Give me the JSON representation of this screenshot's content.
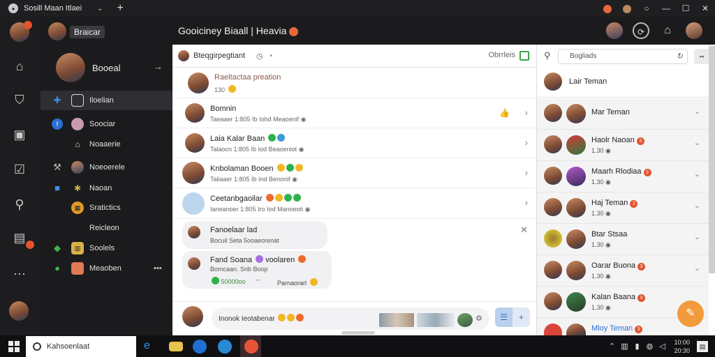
{
  "window": {
    "title": "Sosill Maan Itlaei",
    "controls": [
      "—",
      "☐",
      "✕"
    ]
  },
  "rail": {
    "items": [
      "home-icon",
      "shield-icon",
      "store-icon",
      "checklist-icon",
      "connect-icon",
      "document-icon",
      "more-icon"
    ]
  },
  "sidebar": {
    "header_label": "Braicar",
    "profile_name": "Booeal",
    "items": [
      {
        "label": "Iloelian",
        "lead": "puzzle-icon"
      },
      {
        "label": "Soociar",
        "lead": "circle-icon"
      },
      {
        "label": "Noaaerie",
        "lead": ""
      },
      {
        "label": "Noeoerele",
        "lead": "wrench-icon"
      },
      {
        "label": "Naoan",
        "lead": "folder-icon"
      },
      {
        "label": "Sratictics",
        "lead": ""
      },
      {
        "label": "Reicleon",
        "lead": ""
      },
      {
        "label": "Soolels",
        "lead": "leaf-icon"
      },
      {
        "label": "Meaoben",
        "lead": "status-icon",
        "trailing": "•••"
      }
    ]
  },
  "header": {
    "title": "Gooiciney Biaall | Heavia"
  },
  "chat": {
    "title": "Bteqgirpegtiant",
    "clock": "◷",
    "right_label": "Obrrleis",
    "messages": [
      {
        "name": "Raeltactaa preation",
        "sub": "130"
      },
      {
        "name": "Bomnin",
        "sub": "Taeaaer 1:805 Ib Iohd Meaoenif"
      },
      {
        "name": "Laia Kalar Baan",
        "sub": "Talaocn 1:805 Ib Iod Beaoeniot"
      },
      {
        "name": "Knbolaman Booen",
        "sub": "Taliaaer 1:805 Ib Ind Benonif"
      },
      {
        "name": "Ceetanbgaoilar",
        "sub": "Ianeanoer 1:805 Iro Iod Manoeoti"
      }
    ],
    "bubble1": {
      "name": "Fanoelaar lad",
      "sub": "Bocuil Seta 5ooaeorenat"
    },
    "bubble2": {
      "name": "Fand Soana",
      "tag": "voolaren",
      "sub": "Bomcaan. Srib Boop",
      "sub2": "50000oo",
      "sub3": "Parnaorarl"
    },
    "composer_placeholder": "Inonok Ieotabenar"
  },
  "contacts": {
    "search_placeholder": "Bogliads",
    "first": "Lair Teman",
    "rows": [
      {
        "name": "Mar Teman",
        "sub": "",
        "badge": ""
      },
      {
        "name": "Haolr Naoan",
        "sub": "1.30",
        "badge": "3"
      },
      {
        "name": "Maarh Rlodiaa",
        "sub": "1.30",
        "badge": "2"
      },
      {
        "name": "Haj Teman",
        "sub": "1.30",
        "badge": "2"
      },
      {
        "name": "Btar Stsaa",
        "sub": "1.30",
        "badge": ""
      },
      {
        "name": "Oarar Buona",
        "sub": "1.30",
        "badge": "3"
      },
      {
        "name": "Kalan Baana",
        "sub": "1.30",
        "badge": "3"
      },
      {
        "name": "Mloy Teman",
        "sub": "",
        "badge": "3"
      }
    ]
  },
  "taskbar": {
    "search_placeholder": "Kahsoenlaat",
    "time": "10:00",
    "date": "20:30"
  }
}
